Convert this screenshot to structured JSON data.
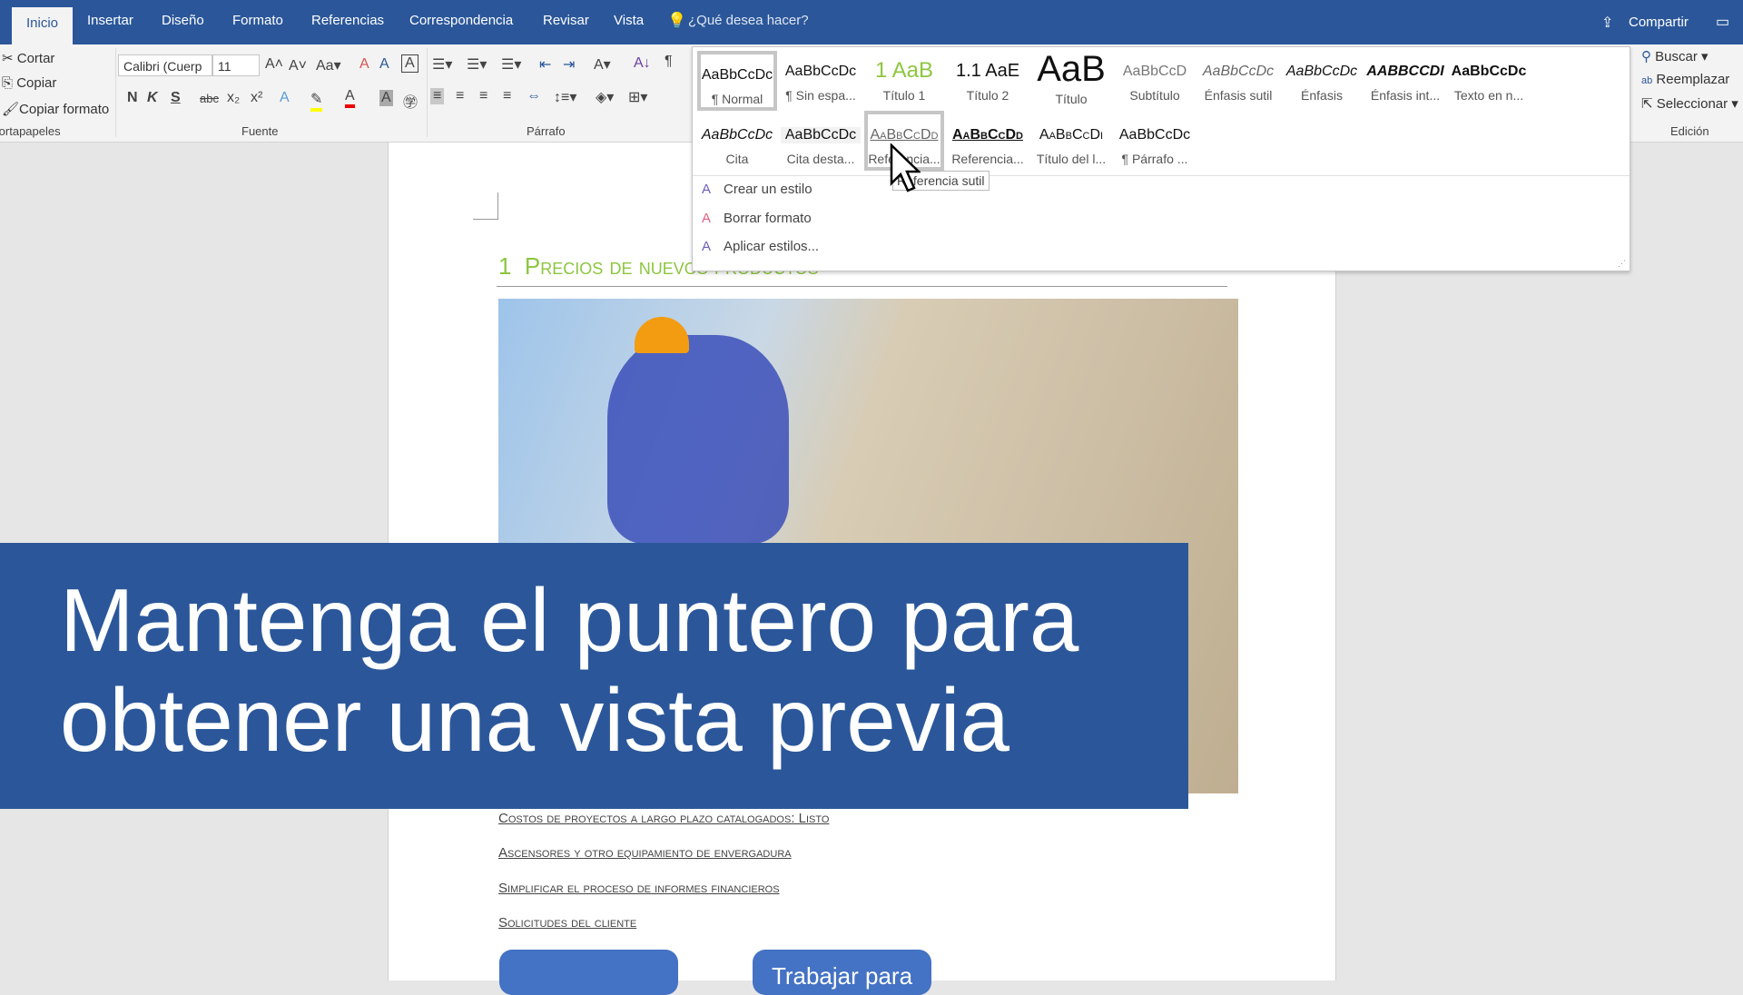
{
  "tabs": [
    "Inicio",
    "Insertar",
    "Diseño",
    "Formato",
    "Referencias",
    "Correspondencia",
    "Revisar",
    "Vista"
  ],
  "tell_me": "¿Qué desea hacer?",
  "share": "Compartir",
  "clipboard": {
    "cut": "Cortar",
    "copy": "Copiar",
    "format_painter": "Copiar formato",
    "group": "Portapapeles"
  },
  "font": {
    "name": "Calibri (Cuerp",
    "size": "11",
    "group": "Fuente",
    "bold": "N",
    "italic": "K",
    "underline": "S"
  },
  "paragraph": {
    "group": "Párrafo"
  },
  "editing": {
    "find": "Buscar",
    "replace": "Reemplazar",
    "select": "Seleccionar",
    "group": "Edición"
  },
  "styles": [
    {
      "preview": "AaBbCcDc",
      "label": "¶ Normal"
    },
    {
      "preview": "AaBbCcDc",
      "label": "¶ Sin espa..."
    },
    {
      "preview": "1 AaB",
      "label": "Título 1"
    },
    {
      "preview": "1.1 AaE",
      "label": "Título 2"
    },
    {
      "preview": "AaB",
      "label": "Título"
    },
    {
      "preview": "AaBbCcD",
      "label": "Subtítulo"
    },
    {
      "preview": "AaBbCcDc",
      "label": "Énfasis sutil"
    },
    {
      "preview": "AaBbCcDc",
      "label": "Énfasis"
    },
    {
      "preview": "AABBCCDI",
      "label": "Énfasis int..."
    },
    {
      "preview": "AaBbCcDc",
      "label": "Texto en n..."
    },
    {
      "preview": "AaBbCcDc",
      "label": "Cita"
    },
    {
      "preview": "AaBbCcDc",
      "label": "Cita desta..."
    },
    {
      "preview": "AaBbCcDd",
      "label": "Referencia..."
    },
    {
      "preview": "AaBbCcDd",
      "label": "Referencia..."
    },
    {
      "preview": "AaBbCcDi",
      "label": "Título del l..."
    },
    {
      "preview": "AaBbCcDc",
      "label": "¶ Párrafo ..."
    }
  ],
  "style_menu": [
    "Crear un estilo",
    "Borrar formato",
    "Aplicar estilos..."
  ],
  "tooltip": "Referencia sutil",
  "doc": {
    "heading_num": "1",
    "heading": "Precios de nuevos productos",
    "links": [
      "Costos de proyectos a largo plazo catalogados: Listo",
      "Ascensores y otro equipamiento de envergadura",
      "Simplificar el proceso de informes financieros",
      "Solicitudes del cliente"
    ],
    "buttons": [
      "",
      "Trabajar para"
    ]
  },
  "banner": {
    "line1": "Mantenga el puntero para",
    "line2": "obtener una vista previa"
  },
  "colors": {
    "brand": "#2b579a",
    "heading": "#8dc63f",
    "button": "#4472c4"
  }
}
